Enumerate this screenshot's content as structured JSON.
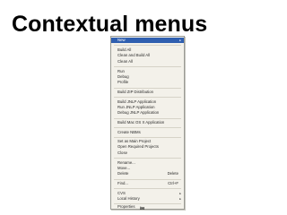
{
  "slide": {
    "title": "Contextual menus"
  },
  "menu": {
    "items": [
      {
        "label": "New",
        "shortcut": "",
        "submenu": true,
        "selected": true
      },
      {
        "label": "Build All",
        "shortcut": "",
        "submenu": false
      },
      {
        "label": "Clean and Build All",
        "shortcut": "",
        "submenu": false
      },
      {
        "label": "Clean All",
        "shortcut": "",
        "submenu": false
      },
      {
        "label": "Run",
        "shortcut": "",
        "submenu": false
      },
      {
        "label": "Debug",
        "shortcut": "",
        "submenu": false
      },
      {
        "label": "Profile",
        "shortcut": "",
        "submenu": false
      },
      {
        "label": "Build ZIP Distribution",
        "shortcut": "",
        "submenu": false
      },
      {
        "label": "Build JNLP Application",
        "shortcut": "",
        "submenu": false
      },
      {
        "label": "Run JNLP Application",
        "shortcut": "",
        "submenu": false
      },
      {
        "label": "Debug JNLP Application",
        "shortcut": "",
        "submenu": false
      },
      {
        "label": "Build Mac OS X Application",
        "shortcut": "",
        "submenu": false
      },
      {
        "label": "Create NBMs",
        "shortcut": "",
        "submenu": false
      },
      {
        "label": "Set as Main Project",
        "shortcut": "",
        "submenu": false
      },
      {
        "label": "Open Required Projects",
        "shortcut": "",
        "submenu": false
      },
      {
        "label": "Close",
        "shortcut": "",
        "submenu": false
      },
      {
        "label": "Rename...",
        "shortcut": "",
        "submenu": false
      },
      {
        "label": "Move...",
        "shortcut": "",
        "submenu": false
      },
      {
        "label": "Delete",
        "shortcut": "Delete",
        "submenu": false
      },
      {
        "label": "Find...",
        "shortcut": "Ctrl+F",
        "submenu": false
      },
      {
        "label": "CVS",
        "shortcut": "",
        "submenu": true
      },
      {
        "label": "Local History",
        "shortcut": "",
        "submenu": true
      },
      {
        "label": "Properties",
        "shortcut": "",
        "submenu": false
      }
    ]
  },
  "cursor": {
    "label": "/M"
  },
  "colors": {
    "menu_background": "#f3f1ea",
    "selection": "#2f5fb0",
    "separator": "#d6d3c8"
  }
}
